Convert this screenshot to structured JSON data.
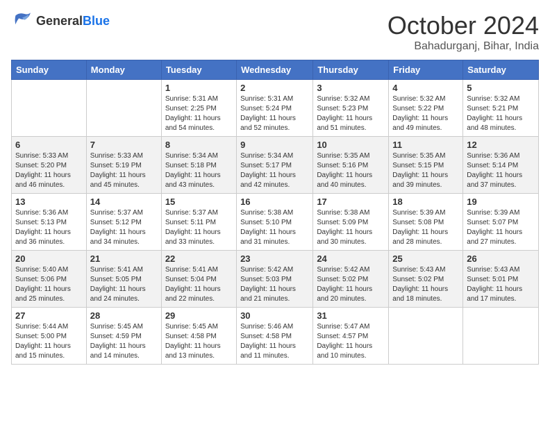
{
  "header": {
    "logo_general": "General",
    "logo_blue": "Blue",
    "month_title": "October 2024",
    "location": "Bahadurganj, Bihar, India"
  },
  "days_of_week": [
    "Sunday",
    "Monday",
    "Tuesday",
    "Wednesday",
    "Thursday",
    "Friday",
    "Saturday"
  ],
  "weeks": [
    [
      {
        "day": "",
        "info": ""
      },
      {
        "day": "",
        "info": ""
      },
      {
        "day": "1",
        "info": "Sunrise: 5:31 AM\nSunset: 2:25 PM\nDaylight: 11 hours\nand 54 minutes."
      },
      {
        "day": "2",
        "info": "Sunrise: 5:31 AM\nSunset: 5:24 PM\nDaylight: 11 hours\nand 52 minutes."
      },
      {
        "day": "3",
        "info": "Sunrise: 5:32 AM\nSunset: 5:23 PM\nDaylight: 11 hours\nand 51 minutes."
      },
      {
        "day": "4",
        "info": "Sunrise: 5:32 AM\nSunset: 5:22 PM\nDaylight: 11 hours\nand 49 minutes."
      },
      {
        "day": "5",
        "info": "Sunrise: 5:32 AM\nSunset: 5:21 PM\nDaylight: 11 hours\nand 48 minutes."
      }
    ],
    [
      {
        "day": "6",
        "info": "Sunrise: 5:33 AM\nSunset: 5:20 PM\nDaylight: 11 hours\nand 46 minutes."
      },
      {
        "day": "7",
        "info": "Sunrise: 5:33 AM\nSunset: 5:19 PM\nDaylight: 11 hours\nand 45 minutes."
      },
      {
        "day": "8",
        "info": "Sunrise: 5:34 AM\nSunset: 5:18 PM\nDaylight: 11 hours\nand 43 minutes."
      },
      {
        "day": "9",
        "info": "Sunrise: 5:34 AM\nSunset: 5:17 PM\nDaylight: 11 hours\nand 42 minutes."
      },
      {
        "day": "10",
        "info": "Sunrise: 5:35 AM\nSunset: 5:16 PM\nDaylight: 11 hours\nand 40 minutes."
      },
      {
        "day": "11",
        "info": "Sunrise: 5:35 AM\nSunset: 5:15 PM\nDaylight: 11 hours\nand 39 minutes."
      },
      {
        "day": "12",
        "info": "Sunrise: 5:36 AM\nSunset: 5:14 PM\nDaylight: 11 hours\nand 37 minutes."
      }
    ],
    [
      {
        "day": "13",
        "info": "Sunrise: 5:36 AM\nSunset: 5:13 PM\nDaylight: 11 hours\nand 36 minutes."
      },
      {
        "day": "14",
        "info": "Sunrise: 5:37 AM\nSunset: 5:12 PM\nDaylight: 11 hours\nand 34 minutes."
      },
      {
        "day": "15",
        "info": "Sunrise: 5:37 AM\nSunset: 5:11 PM\nDaylight: 11 hours\nand 33 minutes."
      },
      {
        "day": "16",
        "info": "Sunrise: 5:38 AM\nSunset: 5:10 PM\nDaylight: 11 hours\nand 31 minutes."
      },
      {
        "day": "17",
        "info": "Sunrise: 5:38 AM\nSunset: 5:09 PM\nDaylight: 11 hours\nand 30 minutes."
      },
      {
        "day": "18",
        "info": "Sunrise: 5:39 AM\nSunset: 5:08 PM\nDaylight: 11 hours\nand 28 minutes."
      },
      {
        "day": "19",
        "info": "Sunrise: 5:39 AM\nSunset: 5:07 PM\nDaylight: 11 hours\nand 27 minutes."
      }
    ],
    [
      {
        "day": "20",
        "info": "Sunrise: 5:40 AM\nSunset: 5:06 PM\nDaylight: 11 hours\nand 25 minutes."
      },
      {
        "day": "21",
        "info": "Sunrise: 5:41 AM\nSunset: 5:05 PM\nDaylight: 11 hours\nand 24 minutes."
      },
      {
        "day": "22",
        "info": "Sunrise: 5:41 AM\nSunset: 5:04 PM\nDaylight: 11 hours\nand 22 minutes."
      },
      {
        "day": "23",
        "info": "Sunrise: 5:42 AM\nSunset: 5:03 PM\nDaylight: 11 hours\nand 21 minutes."
      },
      {
        "day": "24",
        "info": "Sunrise: 5:42 AM\nSunset: 5:02 PM\nDaylight: 11 hours\nand 20 minutes."
      },
      {
        "day": "25",
        "info": "Sunrise: 5:43 AM\nSunset: 5:02 PM\nDaylight: 11 hours\nand 18 minutes."
      },
      {
        "day": "26",
        "info": "Sunrise: 5:43 AM\nSunset: 5:01 PM\nDaylight: 11 hours\nand 17 minutes."
      }
    ],
    [
      {
        "day": "27",
        "info": "Sunrise: 5:44 AM\nSunset: 5:00 PM\nDaylight: 11 hours\nand 15 minutes."
      },
      {
        "day": "28",
        "info": "Sunrise: 5:45 AM\nSunset: 4:59 PM\nDaylight: 11 hours\nand 14 minutes."
      },
      {
        "day": "29",
        "info": "Sunrise: 5:45 AM\nSunset: 4:58 PM\nDaylight: 11 hours\nand 13 minutes."
      },
      {
        "day": "30",
        "info": "Sunrise: 5:46 AM\nSunset: 4:58 PM\nDaylight: 11 hours\nand 11 minutes."
      },
      {
        "day": "31",
        "info": "Sunrise: 5:47 AM\nSunset: 4:57 PM\nDaylight: 11 hours\nand 10 minutes."
      },
      {
        "day": "",
        "info": ""
      },
      {
        "day": "",
        "info": ""
      }
    ]
  ]
}
